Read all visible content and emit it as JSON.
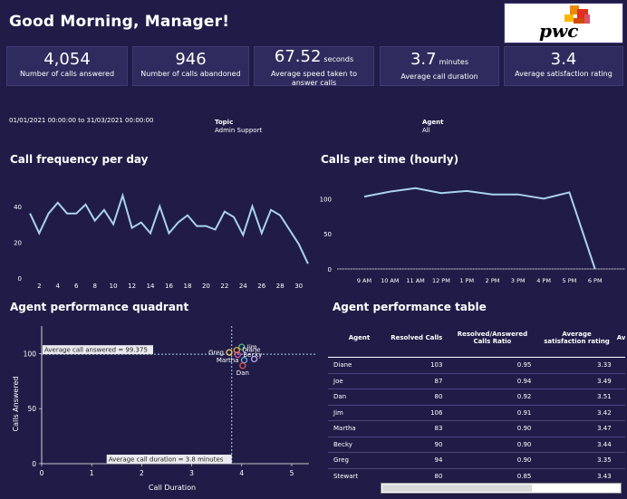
{
  "header": {
    "greeting": "Good Morning, Manager!",
    "logo_text": "pwc"
  },
  "kpis": [
    {
      "value": "4,054",
      "unit": "",
      "label": "Number of calls answered"
    },
    {
      "value": "946",
      "unit": "",
      "label": "Number of calls abandoned"
    },
    {
      "value": "67.52",
      "unit": "seconds",
      "label": "Average speed taken to answer calls"
    },
    {
      "value": "3.7",
      "unit": "minutes",
      "label": "Average call duration"
    },
    {
      "value": "3.4",
      "unit": "",
      "label": "Average satisfaction rating"
    }
  ],
  "filters": {
    "date_range": "01/01/2021 00:00:00 to 31/03/2021 00:00:00",
    "topic_label": "Topic",
    "topic_value": "Admin Support",
    "agent_label": "Agent",
    "agent_value": "All"
  },
  "colors": {
    "background": "#211c47",
    "line": "#a9d2ef",
    "panel": "#2f2b5e"
  },
  "chart_data": [
    {
      "type": "line",
      "title": "Call frequency per day",
      "x": [
        1,
        2,
        3,
        4,
        5,
        6,
        7,
        8,
        9,
        10,
        11,
        12,
        13,
        14,
        15,
        16,
        17,
        18,
        19,
        20,
        21,
        22,
        23,
        24,
        25,
        26,
        27,
        28,
        29,
        30,
        31
      ],
      "values": [
        36,
        25,
        36,
        42,
        36,
        36,
        41,
        32,
        38,
        30,
        46,
        28,
        31,
        25,
        40,
        25,
        31,
        35,
        29,
        29,
        27,
        37,
        34,
        24,
        40,
        25,
        38,
        35,
        27,
        19,
        8
      ],
      "xticks": [
        2,
        4,
        6,
        8,
        10,
        12,
        14,
        16,
        18,
        20,
        22,
        24,
        26,
        28,
        30
      ],
      "yticks": [
        0,
        20,
        40
      ],
      "xlim": [
        0.5,
        31.5
      ],
      "ylim": [
        0,
        50
      ]
    },
    {
      "type": "line",
      "title": "Calls per time (hourly)",
      "categories": [
        "9 AM",
        "10 AM",
        "11 AM",
        "12 PM",
        "1 PM",
        "2 PM",
        "3 PM",
        "4 PM",
        "5 PM",
        "6 PM"
      ],
      "values": [
        103,
        110,
        115,
        108,
        111,
        106,
        106,
        100,
        109,
        0
      ],
      "yticks": [
        0,
        50,
        100
      ],
      "ylim": [
        0,
        125
      ]
    },
    {
      "type": "scatter",
      "title": "Agent performance quadrant",
      "xlabel": "Call Duration",
      "ylabel": "Calls Answered",
      "xticks": [
        0,
        1,
        2,
        3,
        4,
        5
      ],
      "yticks": [
        0,
        50,
        100
      ],
      "xlim": [
        0,
        5.2
      ],
      "ylim": [
        0,
        125
      ],
      "ref_y": {
        "value": 99.375,
        "label": "Average call answered = 99.375"
      },
      "ref_x": {
        "value": 3.8,
        "label": "Average call duration = 3.8 minutes"
      },
      "points": [
        {
          "name": "Jim",
          "x": 4.0,
          "y": 106,
          "color": "#4bbf73"
        },
        {
          "name": "Diane",
          "x": 3.9,
          "y": 103,
          "color": "#e8a33d"
        },
        {
          "name": "Greg",
          "x": 3.75,
          "y": 101,
          "color": "#f4d35e"
        },
        {
          "name": "Becky",
          "x": 3.92,
          "y": 99,
          "color": "#e0529c"
        },
        {
          "name": "Martha",
          "x": 4.05,
          "y": 94,
          "color": "#69b3e7"
        },
        {
          "name": "",
          "x": 4.25,
          "y": 95,
          "color": "#b9a8f0"
        },
        {
          "name": "Dan",
          "x": 4.02,
          "y": 89,
          "color": "#e2574c"
        }
      ]
    }
  ],
  "table": {
    "title": "Agent performance table",
    "columns": [
      "Agent",
      "Resolved Calls",
      "Resolved/Answered Calls Ratio",
      "Average satisfaction rating",
      "Av ans"
    ],
    "rows": [
      [
        "Diane",
        "103",
        "0.95",
        "3.33"
      ],
      [
        "Joe",
        "87",
        "0.94",
        "3.49"
      ],
      [
        "Dan",
        "80",
        "0.92",
        "3.51"
      ],
      [
        "Jim",
        "106",
        "0.91",
        "3.42"
      ],
      [
        "Martha",
        "83",
        "0.90",
        "3.47"
      ],
      [
        "Becky",
        "90",
        "0.90",
        "3.44"
      ],
      [
        "Greg",
        "94",
        "0.90",
        "3.35"
      ],
      [
        "Stewart",
        "80",
        "0.85",
        "3.43"
      ]
    ]
  }
}
